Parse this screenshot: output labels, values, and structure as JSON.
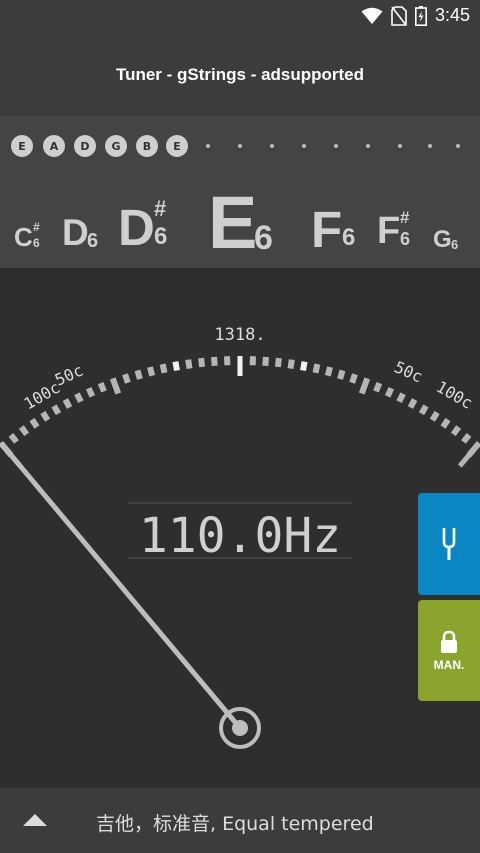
{
  "status_bar": {
    "time": "3:45",
    "icons": [
      "wifi-icon",
      "no-sim-icon",
      "battery-charging-icon"
    ]
  },
  "app_bar": {
    "title": "Tuner - gStrings - adsupported"
  },
  "strings": {
    "chips": [
      "E",
      "A",
      "D",
      "G",
      "B",
      "E"
    ],
    "dot_count": 9
  },
  "notes": [
    {
      "letter": "C",
      "sharp": "#",
      "octave": "6"
    },
    {
      "letter": "D",
      "sharp": "",
      "octave": "6"
    },
    {
      "letter": "D",
      "sharp": "#",
      "octave": "6"
    },
    {
      "letter": "E",
      "sharp": "",
      "octave": "6"
    },
    {
      "letter": "F",
      "sharp": "",
      "octave": "6"
    },
    {
      "letter": "F",
      "sharp": "#",
      "octave": "6"
    },
    {
      "letter": "G",
      "sharp": "",
      "octave": "6"
    }
  ],
  "meter": {
    "target_frequency": "1318.",
    "left_labels": [
      "100c",
      "50c"
    ],
    "right_labels": [
      "50c",
      "100c"
    ],
    "frequency_display": "110.0Hz",
    "needle_cents": -100
  },
  "side_buttons": {
    "fork_icon": "tuning-fork-icon",
    "lock_icon": "lock-icon",
    "manual_label": "MAN."
  },
  "bottom_bar": {
    "tuning": "吉他，标准音, Equal tempered",
    "expand_icon": "triangle-up-icon"
  },
  "colors": {
    "fork_button": "#0a87c2",
    "manual_button": "#8aa42d",
    "background": "#2e2e2e",
    "bar": "#3c3c3c"
  }
}
